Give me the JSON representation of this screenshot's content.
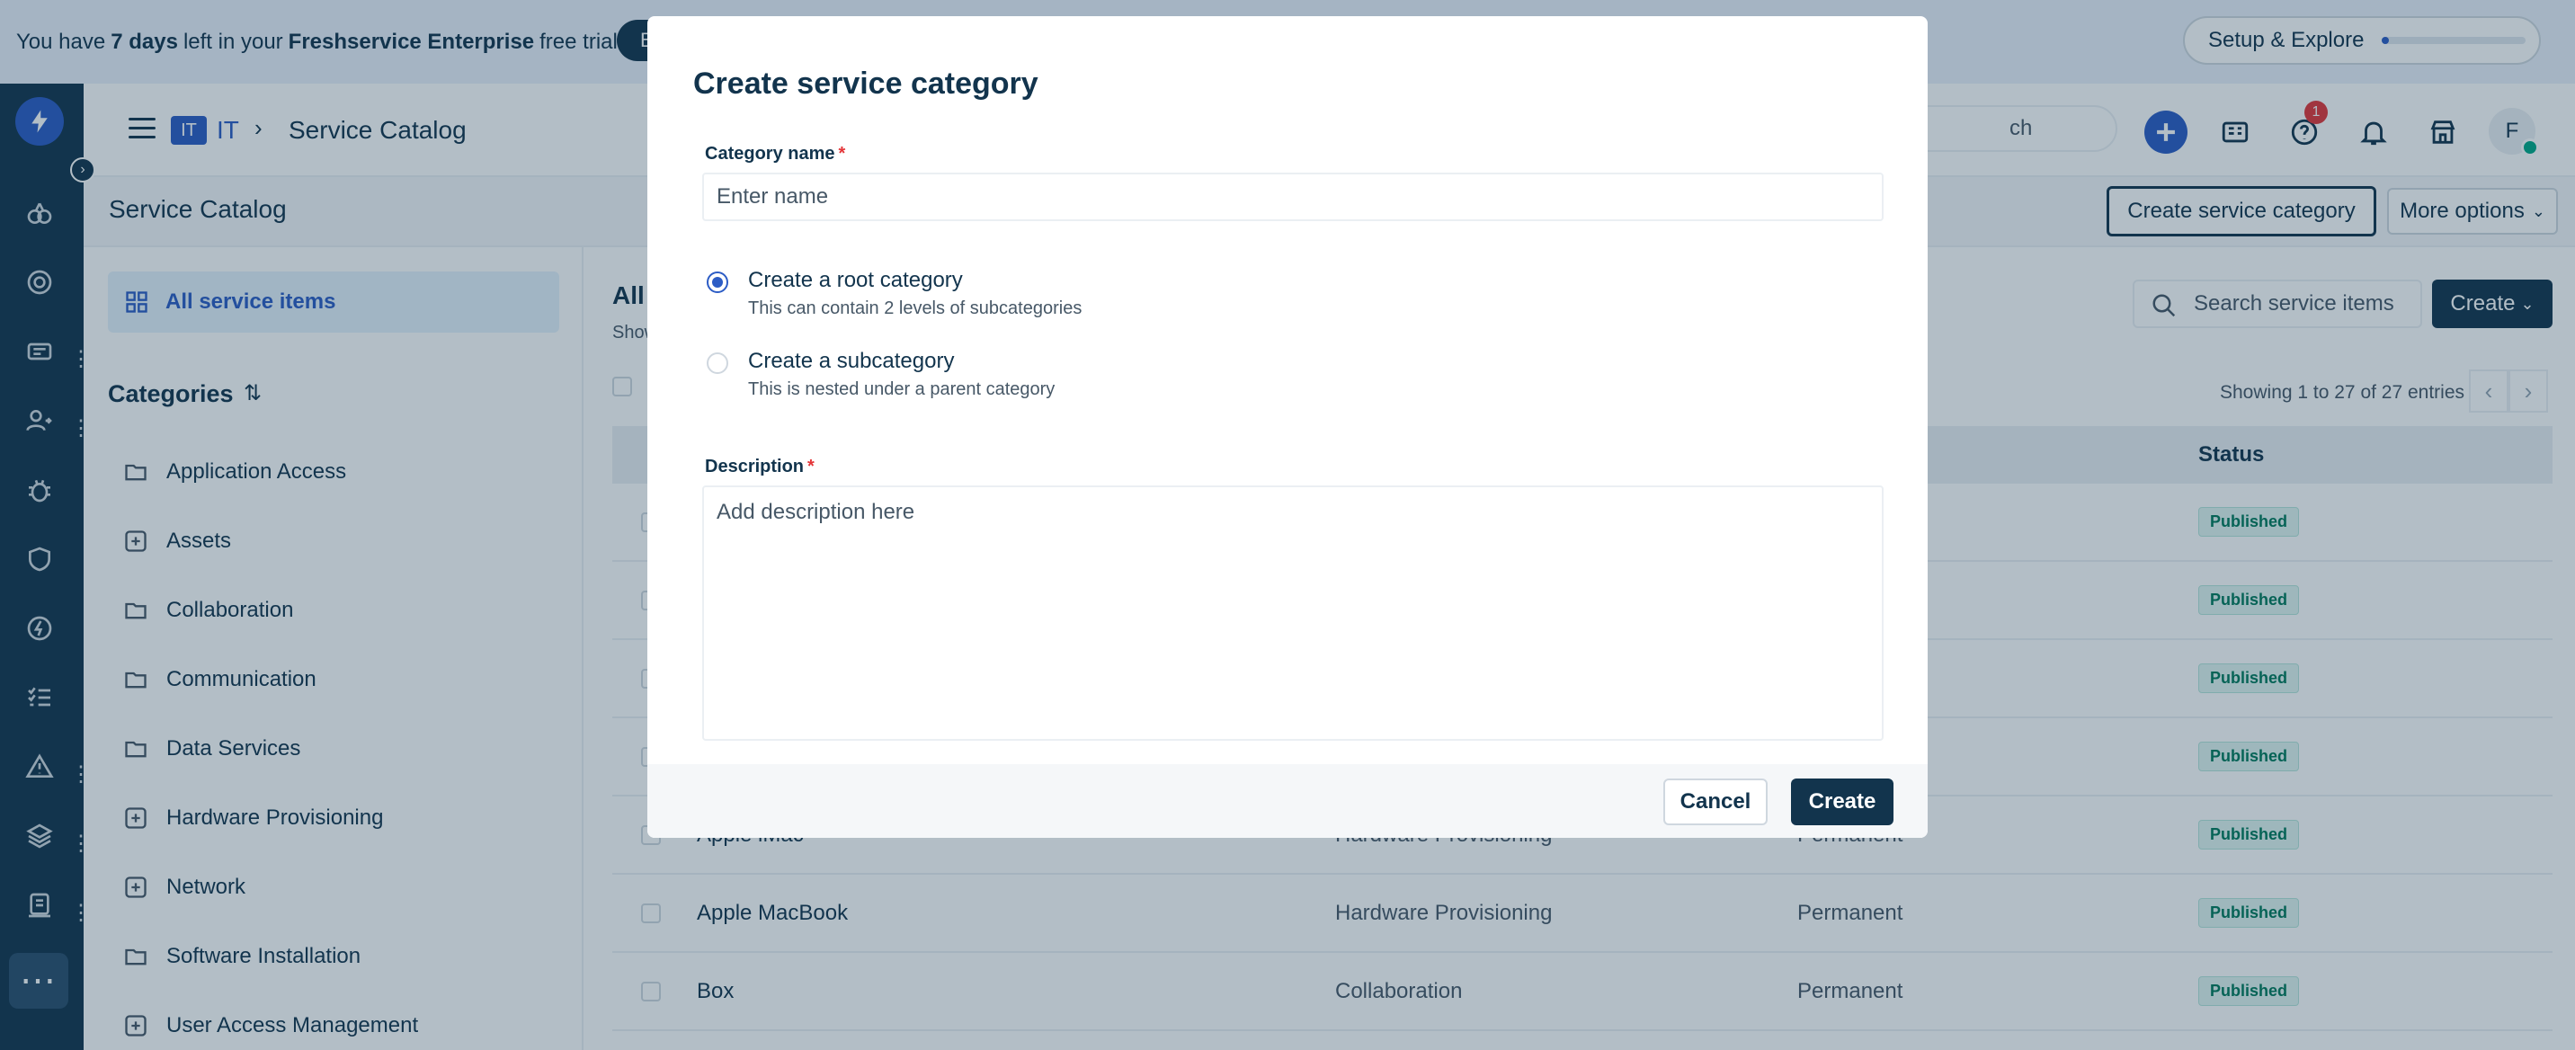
{
  "trial_banner": {
    "prefix": "You have ",
    "days": "7 days",
    "middle": " left in your ",
    "plan": "Freshservice Enterprise",
    "suffix": " free trial",
    "button_label": "B"
  },
  "setup": {
    "label": "Setup & Explore",
    "progress": 0.05
  },
  "header": {
    "workspace_badge": "IT",
    "workspace_name": "IT",
    "breadcrumb_sep": "›",
    "breadcrumb_title": "Service Catalog",
    "search_placeholder": "ch",
    "notification_count": "1",
    "avatar_initial": "F"
  },
  "subheader": {
    "title": "Service Catalog",
    "create_category_label": "Create service category",
    "more_options_label": "More options"
  },
  "sidebar": {
    "all_items_label": "All service items",
    "categories_heading": "Categories",
    "categories": [
      {
        "label": "Application Access",
        "icon": "folder-icon"
      },
      {
        "label": "Assets",
        "icon": "plus-square-icon"
      },
      {
        "label": "Collaboration",
        "icon": "folder-icon"
      },
      {
        "label": "Communication",
        "icon": "folder-icon"
      },
      {
        "label": "Data Services",
        "icon": "folder-icon"
      },
      {
        "label": "Hardware Provisioning",
        "icon": "plus-square-icon"
      },
      {
        "label": "Network",
        "icon": "plus-square-icon"
      },
      {
        "label": "Software Installation",
        "icon": "folder-icon"
      },
      {
        "label": "User Access Management",
        "icon": "plus-square-icon"
      }
    ]
  },
  "main": {
    "title": "All",
    "subtitle": "Show",
    "search_placeholder": "Search service items",
    "create_label": "Create",
    "showing_text": "Showing 1 to 27 of 27 entries",
    "columns": {
      "status": "Status"
    },
    "rows": [
      {
        "name": "",
        "category": "",
        "type": "",
        "status": "Published"
      },
      {
        "name": "",
        "category": "",
        "type": "",
        "status": "Published"
      },
      {
        "name": "",
        "category": "",
        "type": "",
        "status": "Published"
      },
      {
        "name": "",
        "category": "",
        "type": "",
        "status": "Published"
      },
      {
        "name": "Apple iMac",
        "category": "Hardware Provisioning",
        "type": "Permanent",
        "status": "Published"
      },
      {
        "name": "Apple MacBook",
        "category": "Hardware Provisioning",
        "type": "Permanent",
        "status": "Published"
      },
      {
        "name": "Box",
        "category": "Collaboration",
        "type": "Permanent",
        "status": "Published"
      }
    ]
  },
  "modal": {
    "title": "Create service category",
    "name_label": "Category name",
    "required_mark": "*",
    "name_placeholder": "Enter name",
    "options": [
      {
        "title": "Create a root category",
        "help": "This can contain 2 levels of subcategories",
        "selected": true
      },
      {
        "title": "Create a subcategory",
        "help": "This is nested under a parent category",
        "selected": false
      }
    ],
    "description_label": "Description",
    "description_placeholder": "Add description here",
    "cancel_label": "Cancel",
    "create_label": "Create"
  },
  "colors": {
    "primary": "#2c5cc5",
    "dark": "#12344d",
    "published_bg": "#e0f5f1",
    "published_text": "#00795b",
    "danger": "#e43538"
  }
}
